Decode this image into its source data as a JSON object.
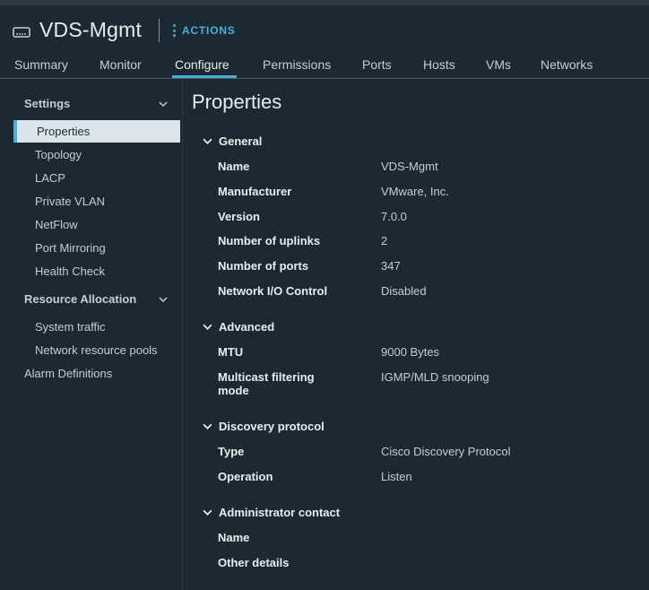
{
  "header": {
    "object_icon": "switch-icon",
    "title": "VDS-Mgmt",
    "actions_label": "ACTIONS",
    "actions_icon": "kebab-icon"
  },
  "tabs": [
    {
      "label": "Summary"
    },
    {
      "label": "Monitor"
    },
    {
      "label": "Configure",
      "active": true
    },
    {
      "label": "Permissions"
    },
    {
      "label": "Ports"
    },
    {
      "label": "Hosts"
    },
    {
      "label": "VMs"
    },
    {
      "label": "Networks"
    }
  ],
  "sidebar": {
    "settings_group": "Settings",
    "settings_items": [
      "Properties",
      "Topology",
      "LACP",
      "Private VLAN",
      "NetFlow",
      "Port Mirroring",
      "Health Check"
    ],
    "selected_item": "Properties",
    "resource_group": "Resource Allocation",
    "resource_items": [
      "System traffic",
      "Network resource pools"
    ],
    "alarm_definitions": "Alarm Definitions"
  },
  "main": {
    "title": "Properties",
    "sections": {
      "general": {
        "title": "General",
        "rows": [
          {
            "label": "Name",
            "value": "VDS-Mgmt"
          },
          {
            "label": "Manufacturer",
            "value": "VMware, Inc."
          },
          {
            "label": "Version",
            "value": "7.0.0"
          },
          {
            "label": "Number of uplinks",
            "value": "2"
          },
          {
            "label": "Number of ports",
            "value": "347"
          },
          {
            "label": "Network I/O Control",
            "value": "Disabled"
          }
        ]
      },
      "advanced": {
        "title": "Advanced",
        "rows": [
          {
            "label": "MTU",
            "value": "9000 Bytes"
          },
          {
            "label": "Multicast filtering mode",
            "value": "IGMP/MLD snooping"
          }
        ]
      },
      "discovery": {
        "title": "Discovery protocol",
        "rows": [
          {
            "label": "Type",
            "value": "Cisco Discovery Protocol"
          },
          {
            "label": "Operation",
            "value": "Listen"
          }
        ]
      },
      "admin": {
        "title": "Administrator contact",
        "rows": [
          {
            "label": "Name",
            "value": ""
          },
          {
            "label": "Other details",
            "value": ""
          }
        ]
      }
    }
  },
  "colors": {
    "background": "#1b2a32",
    "accent": "#49afd9",
    "selected_bg": "#dbe4ea",
    "text": "#c6cdd1",
    "heading_text": "#e8ecee"
  }
}
